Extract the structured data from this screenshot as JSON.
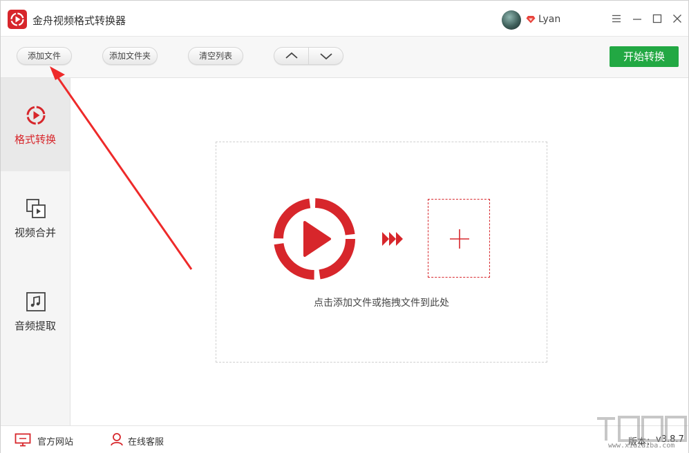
{
  "app": {
    "title": "金舟视频格式转换器",
    "username": "Lyan",
    "brand_color": "#d7262b"
  },
  "toolbar": {
    "add_file": "添加文件",
    "add_folder": "添加文件夹",
    "clear_list": "清空列表",
    "start": "开始转换",
    "start_color": "#22a843"
  },
  "sidebar": {
    "items": [
      {
        "label": "格式转换",
        "icon": "convert-icon",
        "active": true
      },
      {
        "label": "视频合并",
        "icon": "merge-icon",
        "active": false
      },
      {
        "label": "音频提取",
        "icon": "music-note-icon",
        "active": false
      }
    ]
  },
  "dropzone": {
    "hint": "点击添加文件或拖拽文件到此处"
  },
  "footer": {
    "website": "官方网站",
    "service": "在线客服",
    "version_label": "版本：",
    "version": "v3.8.7"
  },
  "watermark": {
    "text": "www.xiazaiba.com"
  }
}
